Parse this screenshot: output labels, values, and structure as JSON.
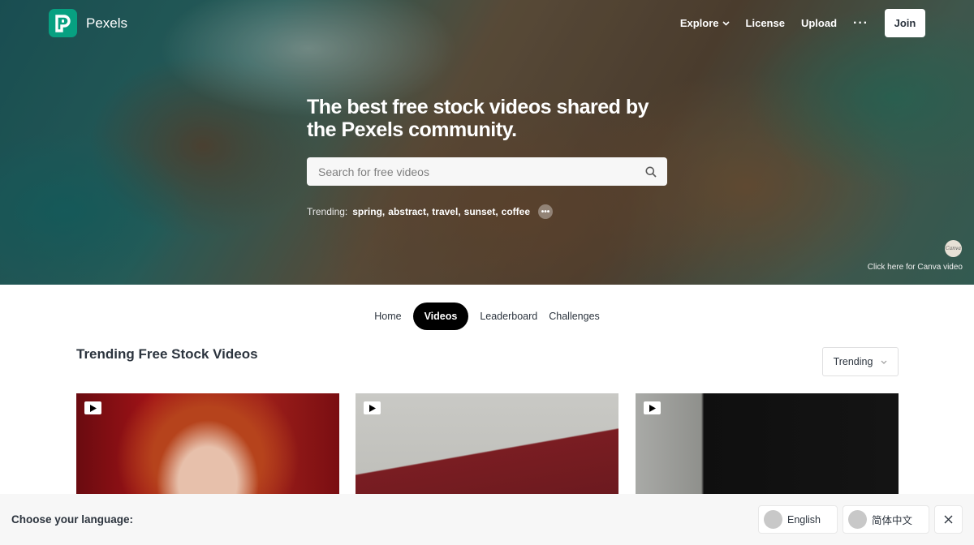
{
  "header": {
    "logo_text": "Pexels",
    "nav": {
      "explore": "Explore",
      "license": "License",
      "upload": "Upload",
      "more": "···",
      "join": "Join"
    }
  },
  "hero": {
    "headline": "The best free stock videos shared by the Pexels community.",
    "search_placeholder": "Search for free videos",
    "trending_label": "Trending:",
    "trending_tags": [
      "spring,",
      "abstract,",
      "travel,",
      "sunset,",
      "coffee"
    ],
    "canva_badge": "Canva",
    "canva_link": "Click here for Canva video"
  },
  "tabs": [
    {
      "label": "Home",
      "active": false
    },
    {
      "label": "Videos",
      "active": true
    },
    {
      "label": "Leaderboard",
      "active": false
    },
    {
      "label": "Challenges",
      "active": false
    }
  ],
  "section": {
    "title": "Trending Free Stock Videos",
    "sort_selected": "Trending"
  },
  "language_bar": {
    "label": "Choose your language:",
    "options": [
      "English",
      "简体中文"
    ]
  },
  "colors": {
    "brand": "#07a081",
    "active_tab": "#000000",
    "text": "#2c343e"
  }
}
